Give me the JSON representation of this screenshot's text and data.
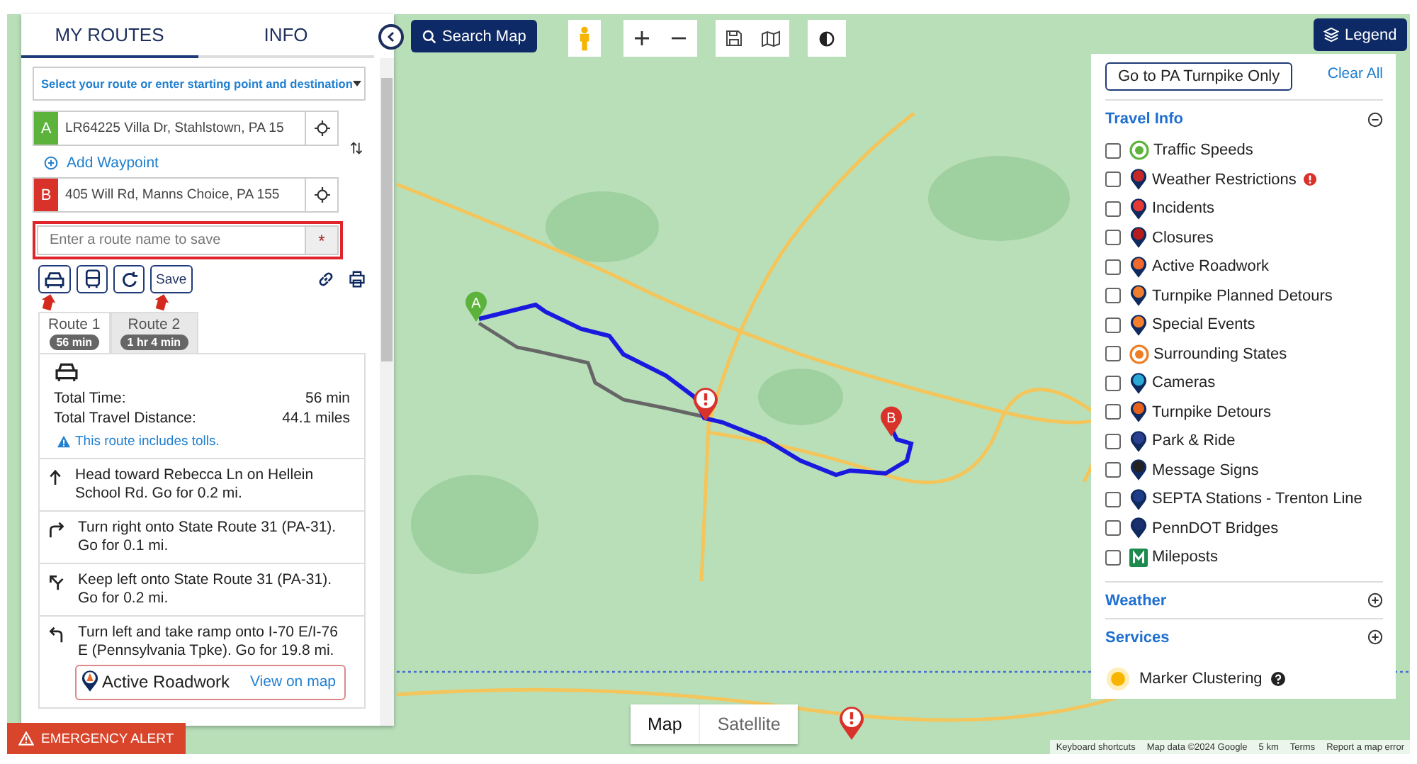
{
  "tabs": [
    {
      "label": "MY ROUTES",
      "selected": true
    },
    {
      "label": "INFO",
      "selected": false
    }
  ],
  "route_select": {
    "placeholder": "Select your route or enter starting point and destination"
  },
  "start": {
    "badge": "A",
    "value": "LR64225 Villa Dr, Stahlstown, PA 15"
  },
  "add_waypoint": "Add Waypoint",
  "end": {
    "badge": "B",
    "value": "405 Will Rd, Manns Choice, PA 155"
  },
  "route_name": {
    "placeholder": "Enter a route name to save",
    "required_mark": "*"
  },
  "save_button": "Save",
  "route_tabs": [
    {
      "label": "Route 1",
      "time": "56 min",
      "selected": true
    },
    {
      "label": "Route 2",
      "time": "1 hr 4 min",
      "selected": false
    }
  ],
  "summary": {
    "rows": [
      {
        "label": "Total Time:",
        "value": "56 min"
      },
      {
        "label": "Total Travel Distance:",
        "value": "44.1 miles"
      }
    ],
    "toll_note": "This route includes tolls."
  },
  "directions": [
    {
      "kind": "straight",
      "text": "Head toward Rebecca Ln on Hellein School Rd. Go for 0.2 mi."
    },
    {
      "kind": "right",
      "text": "Turn right onto State Route 31 (PA-31). Go for 0.1 mi."
    },
    {
      "kind": "keep_left",
      "text": "Keep left onto State Route 31 (PA-31). Go for 0.2 mi."
    },
    {
      "kind": "left",
      "text": "Turn left and take ramp onto I-70 E/I-76 E (Pennsylvania Tpke). Go for 19.8 mi.",
      "alert": {
        "title": "Active Roadwork",
        "link": "View on map"
      }
    }
  ],
  "emergency_alert": "EMERGENCY ALERT",
  "search_map": "Search Map",
  "legend": {
    "button": "Legend",
    "turnpike_button": "Go to PA Turnpike Only",
    "clear_all": "Clear All",
    "sections": [
      {
        "title": "Travel Info",
        "expanded": true,
        "items": [
          {
            "label": "Traffic Speeds",
            "checked": false,
            "kind": "circle",
            "color": "#5cb33b",
            "alert": false
          },
          {
            "label": "Weather Restrictions",
            "checked": false,
            "kind": "pin",
            "color": "#c62828",
            "alert": true
          },
          {
            "label": "Incidents",
            "checked": false,
            "kind": "pin",
            "color": "#e53935",
            "alert": false
          },
          {
            "label": "Closures",
            "checked": false,
            "kind": "pin",
            "color": "#b71c1c",
            "alert": false
          },
          {
            "label": "Active Roadwork",
            "checked": false,
            "kind": "pin",
            "color": "#ee6a2c",
            "alert": false
          },
          {
            "label": "Turnpike Planned Detours",
            "checked": false,
            "kind": "pin",
            "color": "#f07c2e",
            "alert": false
          },
          {
            "label": "Special Events",
            "checked": false,
            "kind": "pin",
            "color": "#f4802f",
            "alert": false
          },
          {
            "label": "Surrounding States",
            "checked": false,
            "kind": "circle",
            "color": "#ef7d22",
            "alert": false
          },
          {
            "label": "Cameras",
            "checked": false,
            "kind": "pin",
            "color": "#2aa8d6",
            "alert": false
          },
          {
            "label": "Turnpike Detours",
            "checked": false,
            "kind": "pin",
            "color": "#e8611a",
            "alert": false
          },
          {
            "label": "Park & Ride",
            "checked": false,
            "kind": "pin",
            "color": "#2b3f8f",
            "alert": false
          },
          {
            "label": "Message Signs",
            "checked": false,
            "kind": "pin",
            "color": "#222222",
            "alert": false
          },
          {
            "label": "SEPTA Stations - Trenton Line",
            "checked": false,
            "kind": "pin",
            "color": "#1f3c88",
            "alert": false
          },
          {
            "label": "PennDOT Bridges",
            "checked": false,
            "kind": "pin",
            "color": "#1a2f6e",
            "alert": false
          },
          {
            "label": "Mileposts",
            "checked": false,
            "kind": "square",
            "color": "#1b8a4c",
            "alert": false
          }
        ]
      },
      {
        "title": "Weather",
        "expanded": false
      },
      {
        "title": "Services",
        "expanded": false
      }
    ],
    "marker_clustering": "Marker Clustering"
  },
  "map": {
    "markers": [
      {
        "label": "A",
        "color": "#5cb33b"
      },
      {
        "label": "B",
        "color": "#d9322b"
      }
    ],
    "type_toggle": [
      {
        "label": "Map",
        "selected": true
      },
      {
        "label": "Satellite",
        "selected": false
      }
    ],
    "attribution": [
      "Keyboard shortcuts",
      "Map data ©2024 Google",
      "5 km",
      "Terms",
      "Report a map error"
    ]
  }
}
